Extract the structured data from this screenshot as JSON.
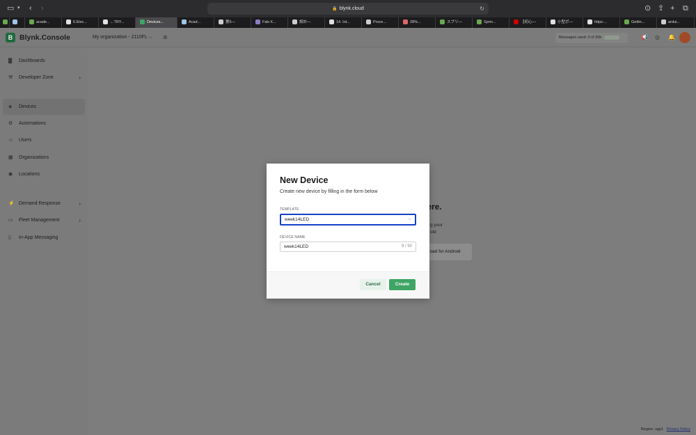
{
  "browser": {
    "url": "blynk.cloud",
    "tabs": [
      {
        "label": "",
        "color": "#6aa84f"
      },
      {
        "label": "",
        "color": "#9fc5e8"
      },
      {
        "label": "acade...",
        "color": "#6aa84f"
      },
      {
        "label": "6.Elec...",
        "color": "#e0e0e0"
      },
      {
        "label": "←TRY...",
        "color": "#e0e0e0"
      },
      {
        "label": "Devices...",
        "color": "#3fa565",
        "active": true
      },
      {
        "label": "Acad...",
        "color": "#9fc5e8"
      },
      {
        "label": "第5—",
        "color": "#cccccc"
      },
      {
        "label": "Fab-X...",
        "color": "#8e7cc3"
      },
      {
        "label": "設計—",
        "color": "#cccccc"
      },
      {
        "label": "14. Int...",
        "color": "#e0e0e0"
      },
      {
        "label": "Proce...",
        "color": "#cccccc"
      },
      {
        "label": "28%...",
        "color": "#e06666"
      },
      {
        "label": "スプリ—",
        "color": "#6aa84f"
      },
      {
        "label": "Sprin...",
        "color": "#6aa84f"
      },
      {
        "label": "【初心—",
        "color": "#cc0000"
      },
      {
        "label": "小型ポ—",
        "color": "#e0e0e0"
      },
      {
        "label": "https:...",
        "color": "#e0e0e0"
      },
      {
        "label": "Gettin...",
        "color": "#6aa84f"
      },
      {
        "label": "ardui...",
        "color": "#cccccc"
      }
    ]
  },
  "app": {
    "logo_letter": "B",
    "logo_text": "Blynk.Console",
    "org": "My organization - 2110FL",
    "messages_used": "Messages used: 0 of 30k",
    "sidebar": [
      {
        "label": "Dashboards",
        "icon": "chart-icon",
        "glyph": "▓",
        "chevron": false
      },
      {
        "label": "Developer Zone",
        "icon": "wrench-icon",
        "glyph": "⚒",
        "chevron": true
      },
      {
        "label": "Devices",
        "icon": "cube-icon",
        "glyph": "◈",
        "chevron": false,
        "active": true
      },
      {
        "label": "Automations",
        "icon": "automation-icon",
        "glyph": "⚙",
        "chevron": false
      },
      {
        "label": "Users",
        "icon": "users-icon",
        "glyph": "☺",
        "chevron": false
      },
      {
        "label": "Organizations",
        "icon": "building-icon",
        "glyph": "▦",
        "chevron": false
      },
      {
        "label": "Locations",
        "icon": "location-pin-icon",
        "glyph": "◉",
        "chevron": false
      },
      {
        "label": "Demand Response",
        "icon": "demand-icon",
        "glyph": "⚡",
        "chevron": true
      },
      {
        "label": "Fleet Management",
        "icon": "truck-icon",
        "glyph": "▭",
        "chevron": true
      },
      {
        "label": "In-App Messaging",
        "icon": "phone-icon",
        "glyph": "▯",
        "chevron": false
      }
    ],
    "background": {
      "heading": "e here.",
      "line1": "g your",
      "line2": "oid",
      "android_button": "load for Android"
    },
    "footer": {
      "region": "Region: sgp1",
      "privacy": "Privacy Policy"
    }
  },
  "dialog": {
    "title": "New Device",
    "subtitle": "Create new device by filling in the form below",
    "template_label": "TEMPLATE",
    "template_value": "week14LED",
    "device_name_label": "DEVICE NAME",
    "device_name_value": "week14LED",
    "char_count": "9 / 50",
    "cancel": "Cancel",
    "create": "Create"
  }
}
